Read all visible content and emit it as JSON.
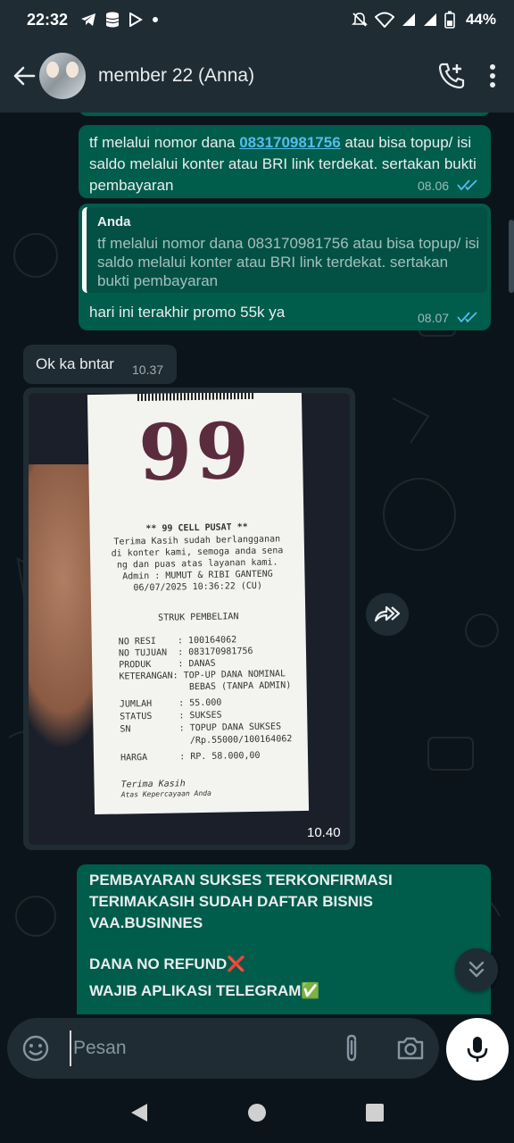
{
  "status_bar": {
    "time": "22:32",
    "battery": "44%",
    "left_icons": [
      "telegram-icon",
      "database-icon",
      "play-store-icon",
      "dot-icon"
    ],
    "right_icons": [
      "mute-icon",
      "wifi-icon",
      "signal-icon",
      "signal-icon",
      "battery-icon"
    ]
  },
  "header": {
    "contact_name": "member 22 (Anna)",
    "icons": [
      "back-arrow-icon",
      "add-call-icon",
      "more-vert-icon"
    ]
  },
  "messages": {
    "m1": {
      "text_before": "tf melalui nomor dana ",
      "phone": "083170981756",
      "text_after": " atau bisa topup/ isi saldo melalui konter atau BRI link terdekat. sertakan bukti pembayaran",
      "time": "08.06"
    },
    "m2": {
      "quote_author": "Anda",
      "quote_text": "tf melalui nomor dana 083170981756 atau bisa topup/ isi saldo melalui konter atau BRI link terdekat. sertakan bukti pembayaran",
      "text": "hari ini terakhir promo 55k ya",
      "time": "08.07"
    },
    "m3": {
      "text": "Ok ka bntar",
      "time": "10.37"
    },
    "m4": {
      "time": "10.40",
      "receipt": {
        "logo": "99",
        "store": "** 99 CELL PUSAT **",
        "line1": "Terima Kasih sudah berlangganan",
        "line2": "di konter kami, semoga anda sena",
        "line3": "ng dan puas atas layanan kami.",
        "line4": "Admin : MUMUT & RIBI GANTENG",
        "line5": "06/07/2025 10:36:22 (CU)",
        "heading": "STRUK PEMBELIAN",
        "rows": [
          "NO RESI    : 100164062",
          "NO TUJUAN  : 083170981756",
          "PRODUK     : DANAS",
          "KETERANGAN: TOP-UP DANA NOMINAL",
          "             BEBAS (TANPA ADMIN)",
          "JUMLAH     : 55.000",
          "STATUS     : SUKSES",
          "SN         : TOPUP DANA SUKSES",
          "             /Rp.55000/100164062",
          "HARGA      : RP. 58.000,00"
        ],
        "footer1": "Terima Kasih",
        "footer2": "Atas Kepercayaan Anda"
      }
    },
    "m5": {
      "line1": "PEMBAYARAN SUKSES TERKONFIRMASI",
      "line2": "TERIMAKASIH SUDAH DAFTAR BISNIS",
      "line3": "VAA.BUSINNES",
      "line4": "DANA NO REFUND❌",
      "line5": "WAJIB APLIKASI TELEGRAM✅"
    }
  },
  "input": {
    "placeholder": "Pesan"
  },
  "colors": {
    "outgoing_bubble": "#005c4b",
    "incoming_bubble": "#202c33",
    "header": "#1f2c34",
    "background": "#0b141a",
    "link": "#53bdeb",
    "read_ticks": "#53bdeb"
  }
}
